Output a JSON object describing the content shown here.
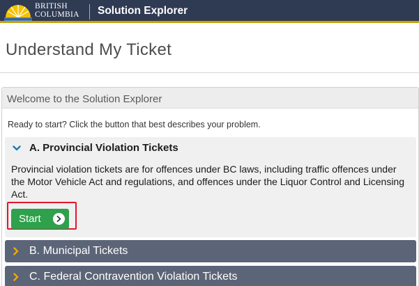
{
  "header": {
    "logo_line1": "BRITISH",
    "logo_line2": "COLUMBIA",
    "app_title": "Solution Explorer",
    "colors": {
      "bar": "#2f3a53",
      "accent": "#c5a100"
    }
  },
  "page": {
    "title": "Understand My Ticket"
  },
  "panel": {
    "heading": "Welcome to the Solution Explorer",
    "intro": "Ready to start? Click the button that best describes your problem.",
    "sections": [
      {
        "label": "A. Provincial Violation Tickets",
        "expanded": true,
        "icon": "chevron-down-icon",
        "body": "Provincial violation tickets are for offences under BC laws, including traffic offences under the Motor Vehicle Act and regulations, and offences under the Liquor Control and Licensing Act.",
        "start_label": "Start"
      },
      {
        "label": "B. Municipal Tickets",
        "expanded": false,
        "icon": "chevron-right-icon"
      },
      {
        "label": "C. Federal Contravention Violation Tickets",
        "expanded": false,
        "icon": "chevron-right-icon"
      }
    ]
  },
  "colors": {
    "start_button": "#2fa04c",
    "highlight": "#e2162b",
    "collapsed_section": "#5c6477",
    "chevron_open": "#1f7ab8",
    "chevron_closed": "#f2a900"
  }
}
